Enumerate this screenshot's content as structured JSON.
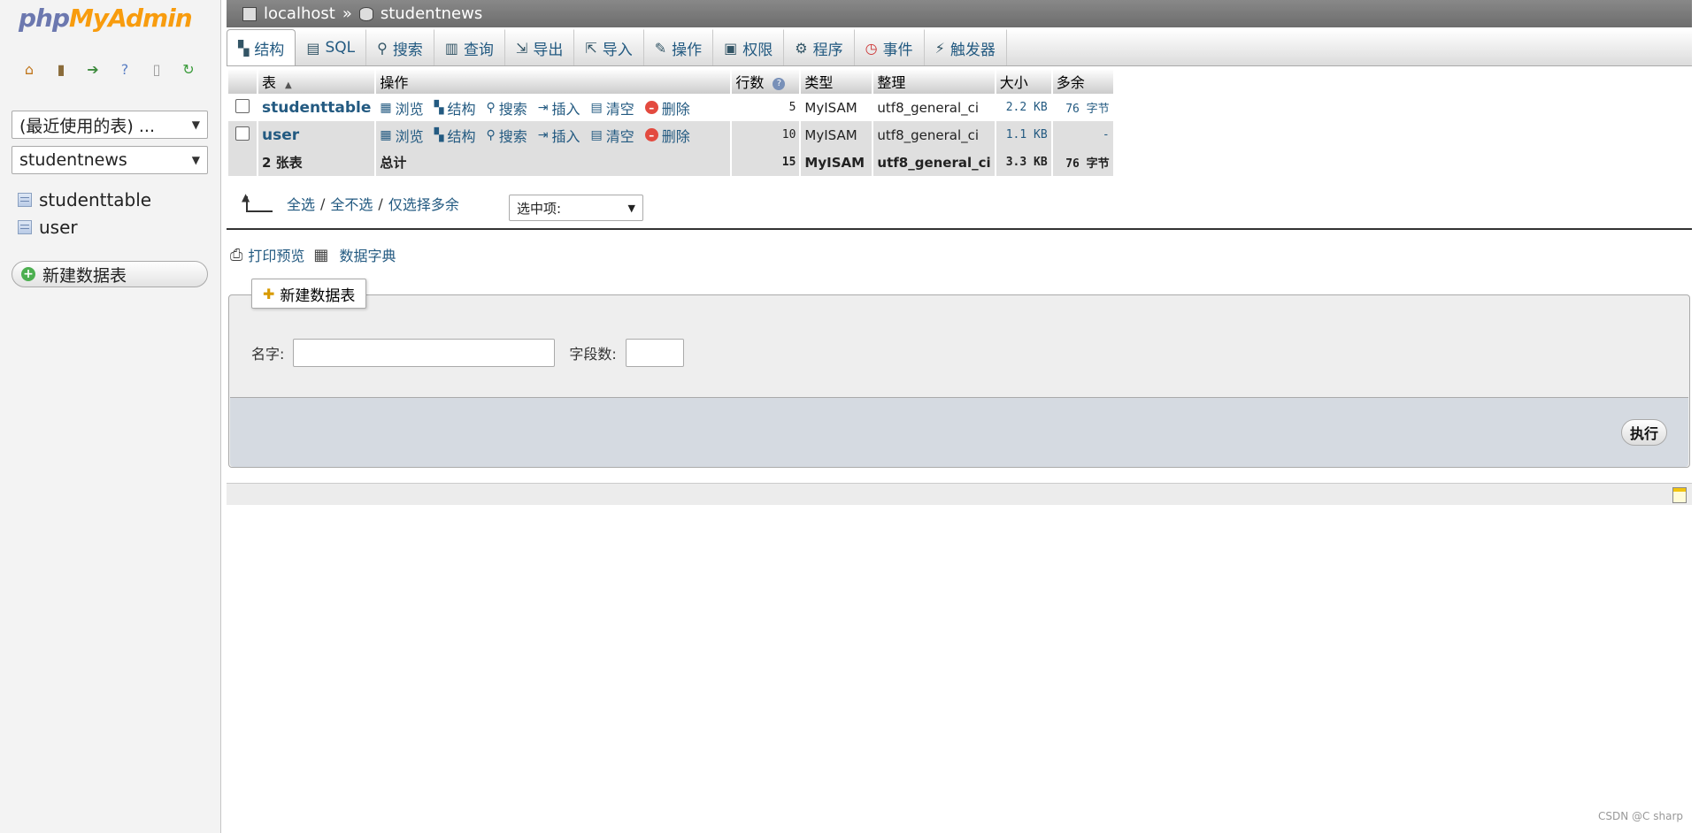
{
  "nav": {
    "logo_part1": "php",
    "logo_part2": "MyAdmin",
    "icons": [
      "home-icon",
      "exit-icon",
      "query-window-icon",
      "help-icon",
      "docs-icon",
      "reload-icon"
    ],
    "recent_tables": "(最近使用的表) ...",
    "database": "studentnews",
    "tables": [
      "studenttable",
      "user"
    ],
    "new_table": "新建数据表"
  },
  "breadcrumb": {
    "server": "localhost",
    "separator": "»",
    "database": "studentnews"
  },
  "tabs": [
    {
      "label": "结构",
      "icon": "structure-icon",
      "active": true
    },
    {
      "label": "SQL",
      "icon": "sql-icon"
    },
    {
      "label": "搜索",
      "icon": "search-icon"
    },
    {
      "label": "查询",
      "icon": "query-icon"
    },
    {
      "label": "导出",
      "icon": "export-icon"
    },
    {
      "label": "导入",
      "icon": "import-icon"
    },
    {
      "label": "操作",
      "icon": "wrench-icon"
    },
    {
      "label": "权限",
      "icon": "privileges-icon"
    },
    {
      "label": "程序",
      "icon": "routines-icon"
    },
    {
      "label": "事件",
      "icon": "events-icon"
    },
    {
      "label": "触发器",
      "icon": "triggers-icon"
    }
  ],
  "table": {
    "headers": {
      "table": "表",
      "action": "操作",
      "rows": "行数",
      "type": "类型",
      "collation": "整理",
      "size": "大小",
      "overhead": "多余"
    },
    "actions": {
      "browse": "浏览",
      "structure": "结构",
      "search": "搜索",
      "insert": "插入",
      "empty": "清空",
      "drop": "删除"
    },
    "rows": [
      {
        "name": "studenttable",
        "rows": "5",
        "type": "MyISAM",
        "collation": "utf8_general_ci",
        "size": "2.2 KB",
        "overhead": "76 字节"
      },
      {
        "name": "user",
        "rows": "10",
        "type": "MyISAM",
        "collation": "utf8_general_ci",
        "size": "1.1 KB",
        "overhead": "-"
      }
    ],
    "footer": {
      "count": "2 张表",
      "label": "总计",
      "rows": "15",
      "type": "MyISAM",
      "collation": "utf8_general_ci",
      "size": "3.3 KB",
      "overhead": "76 字节"
    }
  },
  "checkall": {
    "check_all": "全选",
    "uncheck_all": "全不选",
    "check_overhead": "仅选择多余",
    "separator": "/",
    "with_selected": "选中项:"
  },
  "print": {
    "print_view": "打印预览",
    "data_dictionary": "数据字典"
  },
  "create_table": {
    "legend": "新建数据表",
    "name_label": "名字:",
    "name_value": "",
    "fields_label": "字段数:",
    "fields_value": "",
    "go": "执行"
  },
  "watermark": "CSDN @C sharp"
}
